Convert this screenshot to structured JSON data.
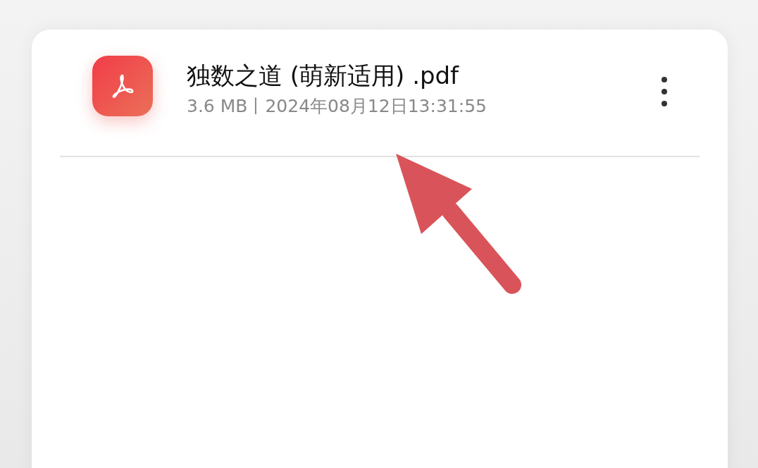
{
  "file": {
    "name": "独数之道 (萌新适用) .pdf",
    "meta": "3.6 MB丨2024年08月12日13:31:55"
  }
}
